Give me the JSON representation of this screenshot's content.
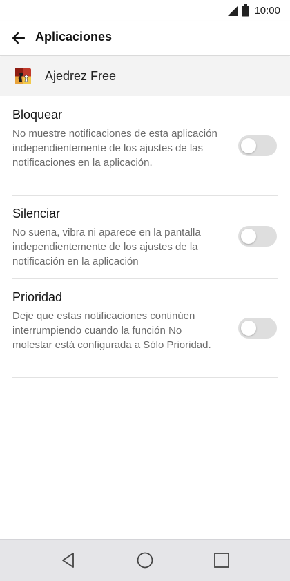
{
  "status_bar": {
    "time": "10:00",
    "icons": [
      "signal-icon",
      "battery-icon"
    ]
  },
  "app_bar": {
    "back_icon": "arrow-left-icon",
    "title": "Aplicaciones"
  },
  "app": {
    "icon": "chess-app-icon",
    "name": "Ajedrez Free"
  },
  "settings": [
    {
      "title": "Bloquear",
      "description": "No muestre notificaciones de esta aplicación independientemente de los ajustes de las notificaciones en la aplicación.",
      "enabled": false
    },
    {
      "title": "Silenciar",
      "description": "No suena, vibra ni aparece en la pantalla independientemente de los ajustes de la notificación en la aplicación",
      "enabled": false
    },
    {
      "title": "Prioridad",
      "description": "Deje que estas notificaciones continúen interrumpiendo cuando la función No molestar está configurada a Sólo Prioridad.",
      "enabled": false
    }
  ],
  "nav_bar": {
    "icons": [
      "back-triangle-icon",
      "home-circle-icon",
      "recents-square-icon"
    ]
  },
  "colors": {
    "toggle_off": "#dedede",
    "navbar_bg": "#e5e5e8",
    "app_header_bg": "#f3f3f3",
    "secondary_text": "#6b6b6b"
  }
}
